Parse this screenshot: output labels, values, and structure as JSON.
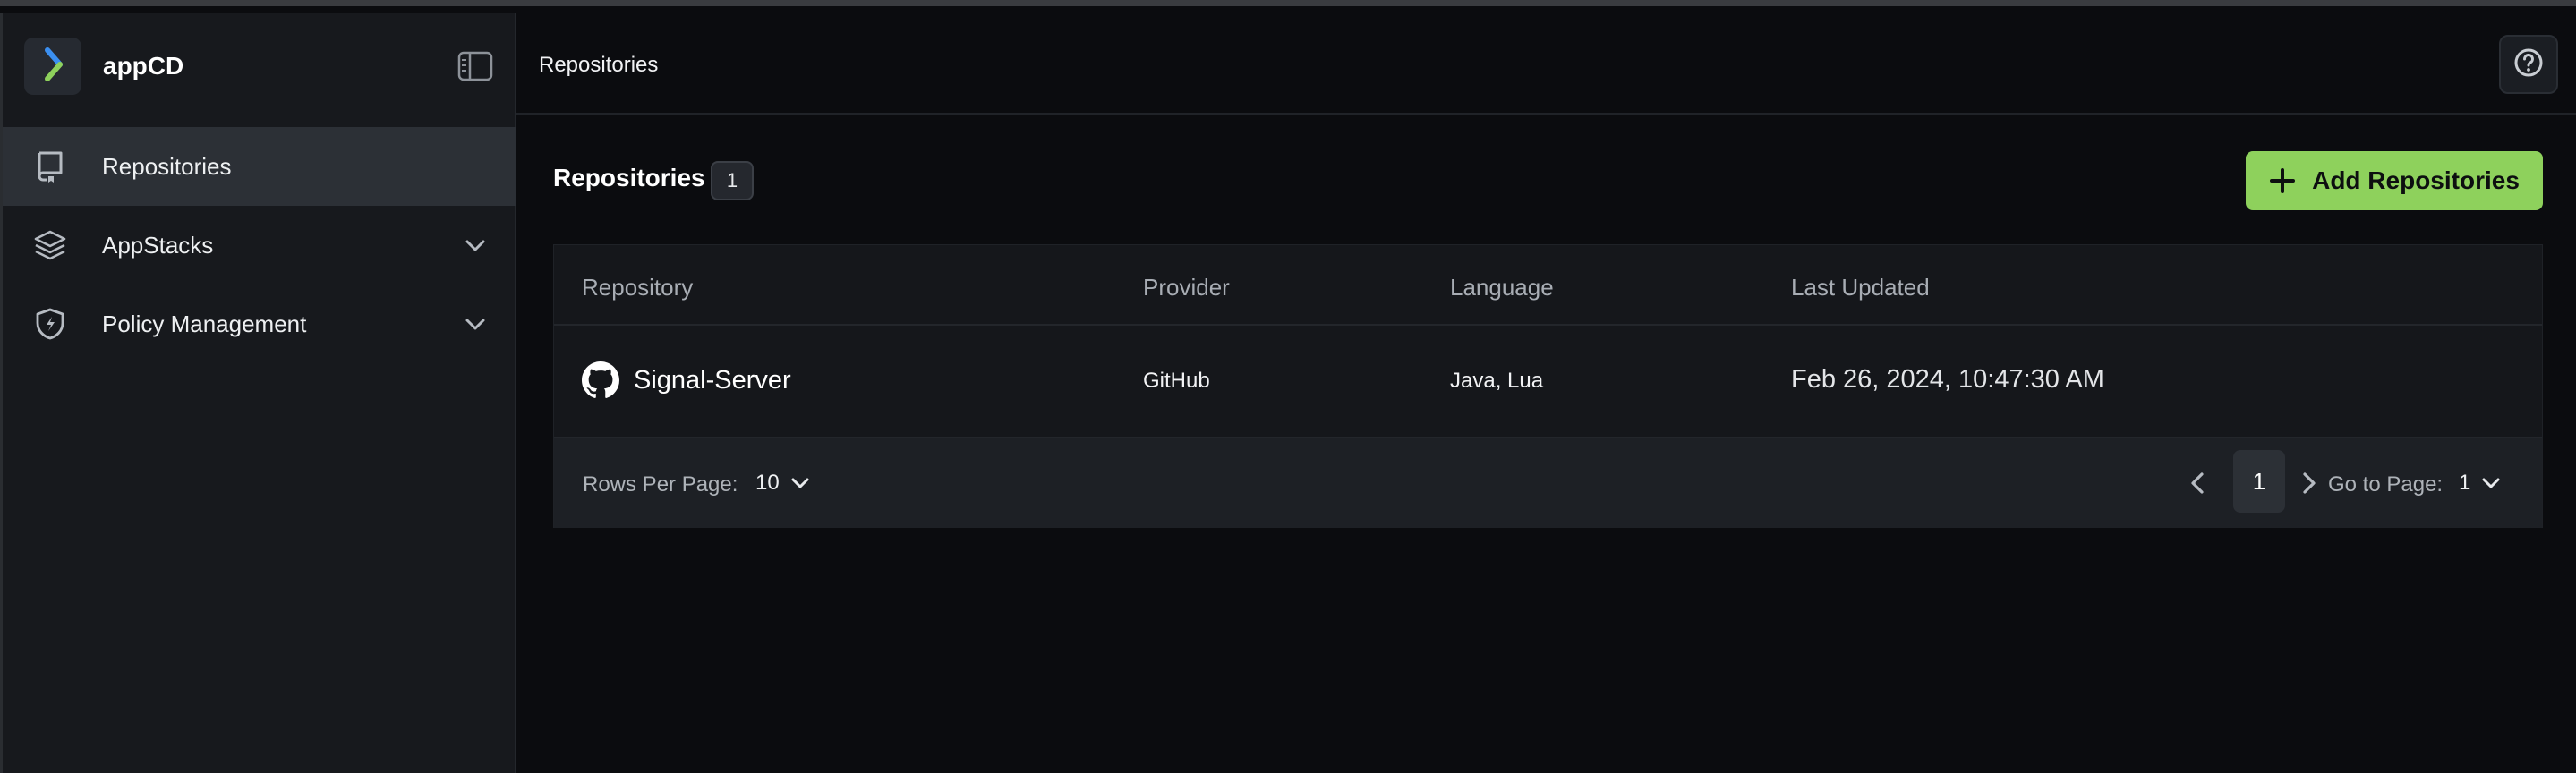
{
  "app": {
    "name": "appCD"
  },
  "sidebar": {
    "items": [
      {
        "label": "Repositories",
        "icon": "repository-icon",
        "active": true
      },
      {
        "label": "AppStacks",
        "icon": "layers-icon",
        "expandable": true
      },
      {
        "label": "Policy Management",
        "icon": "shield-icon",
        "expandable": true
      }
    ]
  },
  "header": {
    "breadcrumb": "Repositories",
    "help_icon": "help-icon"
  },
  "main": {
    "title": "Repositories",
    "count": "1",
    "add_button": "Add Repositories"
  },
  "table": {
    "columns": [
      "Repository",
      "Provider",
      "Language",
      "Last Updated"
    ],
    "rows": [
      {
        "repository": "Signal-Server",
        "icon": "github-icon",
        "provider": "GitHub",
        "language": "Java, Lua",
        "last_updated": "Feb 26, 2024, 10:47:30 AM"
      }
    ]
  },
  "pagination": {
    "rows_per_page_label": "Rows Per Page:",
    "rows_per_page": "10",
    "current_page": "1",
    "go_to_page_label": "Go to Page:",
    "go_to_page": "1"
  },
  "colors": {
    "accent": "#8ed15c",
    "background": "#0b0c0f",
    "sidebar": "#17191d"
  }
}
